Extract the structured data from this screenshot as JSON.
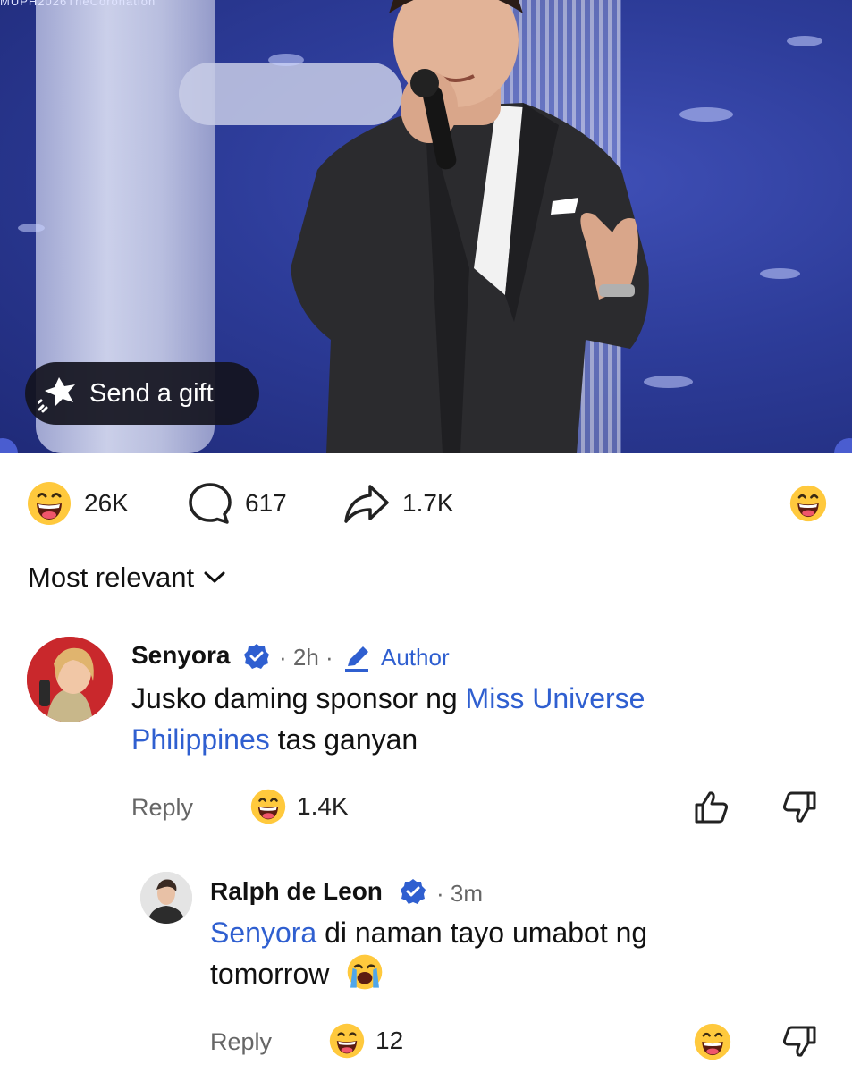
{
  "video": {
    "watermark": "MUPH2026TheCoronation",
    "gift_label": "Send a gift"
  },
  "stats": {
    "reactions": "26K",
    "comments": "617",
    "shares": "1.7K"
  },
  "sort": {
    "label": "Most relevant"
  },
  "comments": [
    {
      "name": "Senyora",
      "time": "· 2h ·",
      "badge": "Author",
      "text_line1": "Jusko daming sponsor ng ",
      "link_line1": "Miss Universe",
      "link_line2": "Philippines",
      "text_line2": " tas ganyan",
      "reply_label": "Reply",
      "reaction_count": "1.4K"
    },
    {
      "name": "Ralph de Leon",
      "time": "· 3m",
      "mention": "Senyora",
      "text_line1": " di naman tayo umabot ng",
      "text_line2": "tomorrow",
      "reply_label": "Reply",
      "reaction_count": "12"
    }
  ],
  "colors": {
    "link": "#2f5fd0",
    "verified": "#2f5fd0",
    "gift_bg": "#14141e"
  },
  "icons": [
    "gift-icon",
    "laughing-emoji-icon",
    "comment-bubble-icon",
    "share-arrow-icon",
    "chevron-down-icon",
    "verified-badge-icon",
    "pencil-icon",
    "thumbs-up-icon",
    "thumbs-down-icon",
    "crying-emoji-icon"
  ]
}
